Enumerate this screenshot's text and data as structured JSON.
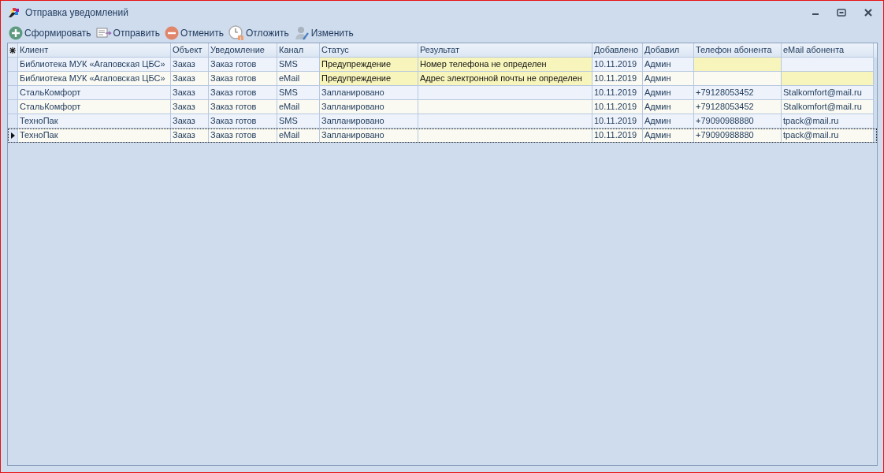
{
  "window": {
    "title": "Отправка уведомлений"
  },
  "toolbar": [
    {
      "label": "Сформировать",
      "kind": "add"
    },
    {
      "label": "Отправить",
      "kind": "send"
    },
    {
      "label": "Отменить",
      "kind": "cancel"
    },
    {
      "label": "Отложить",
      "kind": "postpone"
    },
    {
      "label": "Изменить",
      "kind": "edit"
    }
  ],
  "table": {
    "columns": [
      "Клиент",
      "Объект",
      "Уведомление",
      "Канал",
      "Статус",
      "Результат",
      "Добавлено",
      "Добавил",
      "Телефон абонента",
      "eMail абонента"
    ],
    "rows": [
      {
        "current": false,
        "cells": [
          {
            "text": "Библиотека МУК «Агаповская ЦБС»",
            "highlighted": false
          },
          {
            "text": "Заказ",
            "highlighted": false
          },
          {
            "text": "Заказ готов",
            "highlighted": false
          },
          {
            "text": "SMS",
            "highlighted": false
          },
          {
            "text": "Предупреждение",
            "highlighted": true
          },
          {
            "text": "Номер телефона не определен",
            "highlighted": true
          },
          {
            "text": "10.11.2019",
            "highlighted": false
          },
          {
            "text": "Админ",
            "highlighted": false
          },
          {
            "highlighted": true
          },
          {
            "highlighted": false
          }
        ]
      },
      {
        "current": false,
        "cells": [
          {
            "text": "Библиотека МУК «Агаповская ЦБС»",
            "highlighted": false
          },
          {
            "text": "Заказ",
            "highlighted": false
          },
          {
            "text": "Заказ готов",
            "highlighted": false
          },
          {
            "text": "eMail",
            "highlighted": false
          },
          {
            "text": "Предупреждение",
            "highlighted": true
          },
          {
            "text": "Адрес электронной почты не определен",
            "highlighted": true
          },
          {
            "text": "10.11.2019",
            "highlighted": false
          },
          {
            "text": "Админ",
            "highlighted": false
          },
          {
            "highlighted": false
          },
          {
            "highlighted": true
          }
        ]
      },
      {
        "current": false,
        "cells": [
          {
            "text": "СтальКомфорт",
            "highlighted": false
          },
          {
            "text": "Заказ",
            "highlighted": false
          },
          {
            "text": "Заказ готов",
            "highlighted": false
          },
          {
            "text": "SMS",
            "highlighted": false
          },
          {
            "text": "Запланировано",
            "highlighted": false
          },
          {
            "highlighted": false
          },
          {
            "text": "10.11.2019",
            "highlighted": false
          },
          {
            "text": "Админ",
            "highlighted": false
          },
          {
            "text": "+79128053452",
            "highlighted": false
          },
          {
            "text": "Stalkomfort@mail.ru",
            "highlighted": false
          }
        ]
      },
      {
        "current": false,
        "cells": [
          {
            "text": "СтальКомфорт",
            "highlighted": false
          },
          {
            "text": "Заказ",
            "highlighted": false
          },
          {
            "text": "Заказ готов",
            "highlighted": false
          },
          {
            "text": "eMail",
            "highlighted": false
          },
          {
            "text": "Запланировано",
            "highlighted": false
          },
          {
            "highlighted": false
          },
          {
            "text": "10.11.2019",
            "highlighted": false
          },
          {
            "text": "Админ",
            "highlighted": false
          },
          {
            "text": "+79128053452",
            "highlighted": false
          },
          {
            "text": "Stalkomfort@mail.ru",
            "highlighted": false
          }
        ]
      },
      {
        "current": false,
        "cells": [
          {
            "text": "ТехноПак",
            "highlighted": false
          },
          {
            "text": "Заказ",
            "highlighted": false
          },
          {
            "text": "Заказ готов",
            "highlighted": false
          },
          {
            "text": "SMS",
            "highlighted": false
          },
          {
            "text": "Запланировано",
            "highlighted": false
          },
          {
            "highlighted": false
          },
          {
            "text": "10.11.2019",
            "highlighted": false
          },
          {
            "text": "Админ",
            "highlighted": false
          },
          {
            "text": "+79090988880",
            "highlighted": false
          },
          {
            "text": "tpack@mail.ru",
            "highlighted": false
          }
        ]
      },
      {
        "current": true,
        "cells": [
          {
            "text": "ТехноПак",
            "highlighted": false
          },
          {
            "text": "Заказ",
            "highlighted": false
          },
          {
            "text": "Заказ готов",
            "highlighted": false
          },
          {
            "text": "eMail",
            "highlighted": false
          },
          {
            "text": "Запланировано",
            "highlighted": false
          },
          {
            "highlighted": false
          },
          {
            "text": "10.11.2019",
            "highlighted": false
          },
          {
            "text": "Админ",
            "highlighted": false
          },
          {
            "text": "+79090988880",
            "highlighted": false
          },
          {
            "text": "tpack@mail.ru",
            "highlighted": false
          }
        ]
      }
    ]
  }
}
